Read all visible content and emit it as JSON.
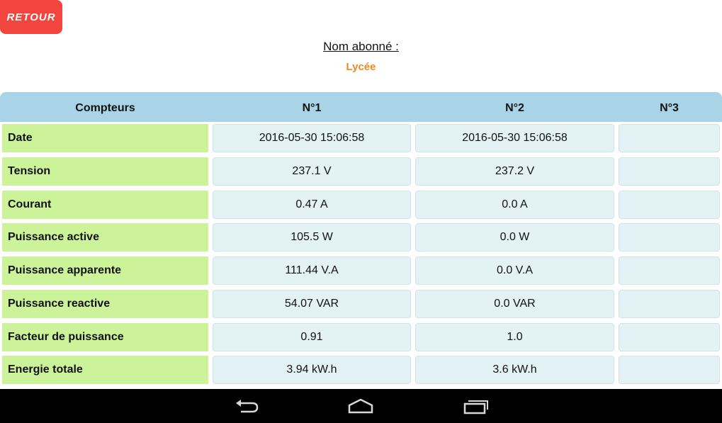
{
  "back_button": {
    "label": "RETOUR"
  },
  "subscriber": {
    "label": "Nom abonné :",
    "name": "Lycée"
  },
  "table": {
    "headers": [
      "Compteurs",
      "N°1",
      "N°2",
      "N°3"
    ],
    "rows": [
      {
        "label": "Date",
        "values": [
          "2016-05-30 15:06:58",
          "2016-05-30 15:06:58",
          ""
        ]
      },
      {
        "label": "Tension",
        "values": [
          "237.1 V",
          "237.2 V",
          ""
        ]
      },
      {
        "label": "Courant",
        "values": [
          "0.47 A",
          "0.0 A",
          ""
        ]
      },
      {
        "label": "Puissance active",
        "values": [
          "105.5 W",
          "0.0 W",
          ""
        ]
      },
      {
        "label": "Puissance apparente",
        "values": [
          "111.44 V.A",
          "0.0 V.A",
          ""
        ]
      },
      {
        "label": "Puissance reactive",
        "values": [
          "54.07 VAR",
          "0.0 VAR",
          ""
        ]
      },
      {
        "label": "Facteur de puissance",
        "values": [
          "0.91",
          "1.0",
          ""
        ]
      },
      {
        "label": "Energie totale",
        "values": [
          "3.94 kW.h",
          "3.6 kW.h",
          ""
        ]
      }
    ]
  },
  "nav_bar": {
    "icons": [
      "back-icon",
      "home-icon",
      "recent-apps-icon"
    ]
  },
  "colors": {
    "back_button": "#f1453d",
    "subscriber_name": "#f08a1c",
    "header_bg": "#a9d4e8",
    "label_bg": "#ccf39a",
    "value_bg": "#e3f2f4"
  }
}
